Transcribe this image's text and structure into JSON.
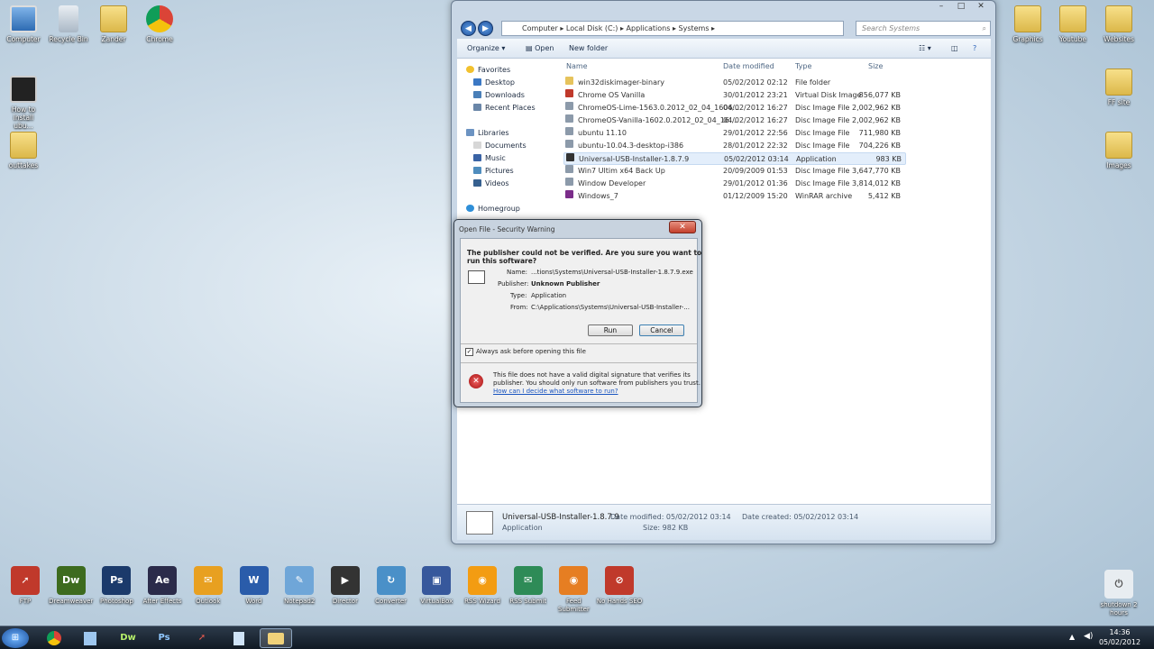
{
  "desktop": {
    "left_icons": [
      "Computer",
      "Recycle Bin",
      "Zander",
      "Chrome"
    ],
    "left_col": [
      "How to install ubu...",
      "outtakes"
    ],
    "right_icons": [
      "Graphics",
      "Youtube",
      "Websites"
    ],
    "right_col": [
      "FF site",
      "Images"
    ]
  },
  "explorer": {
    "breadcrumb": [
      "Computer",
      "Local Disk (C:)",
      "Applications",
      "Systems"
    ],
    "search_placeholder": "Search Systems",
    "toolbar": {
      "organize": "Organize ▾",
      "open": "Open",
      "new_folder": "New folder"
    },
    "nav": {
      "favorites": "Favorites",
      "desktop": "Desktop",
      "downloads": "Downloads",
      "recent": "Recent Places",
      "libraries": "Libraries",
      "documents": "Documents",
      "music": "Music",
      "pictures": "Pictures",
      "videos": "Videos",
      "homegroup": "Homegroup"
    },
    "columns": {
      "name": "Name",
      "date": "Date modified",
      "type": "Type",
      "size": "Size"
    },
    "files": [
      {
        "name": "win32diskimager-binary",
        "date": "05/02/2012 02:12",
        "type": "File folder",
        "size": ""
      },
      {
        "name": "Chrome OS Vanilla",
        "date": "30/01/2012 23:21",
        "type": "Virtual Disk Image",
        "size": "856,077 KB"
      },
      {
        "name": "ChromeOS-Lime-1563.0.2012_02_04_1606...",
        "date": "04/02/2012 16:27",
        "type": "Disc Image File",
        "size": "2,002,962 KB"
      },
      {
        "name": "ChromeOS-Vanilla-1602.0.2012_02_04_16...",
        "date": "04/02/2012 16:27",
        "type": "Disc Image File",
        "size": "2,002,962 KB"
      },
      {
        "name": "ubuntu 11.10",
        "date": "29/01/2012 22:56",
        "type": "Disc Image File",
        "size": "711,980 KB"
      },
      {
        "name": "ubuntu-10.04.3-desktop-i386",
        "date": "28/01/2012 22:32",
        "type": "Disc Image File",
        "size": "704,226 KB"
      },
      {
        "name": "Universal-USB-Installer-1.8.7.9",
        "date": "05/02/2012 03:14",
        "type": "Application",
        "size": "983 KB"
      },
      {
        "name": "Win7 Ultim x64 Back Up",
        "date": "20/09/2009 01:53",
        "type": "Disc Image File",
        "size": "3,647,770 KB"
      },
      {
        "name": "Window Developer",
        "date": "29/01/2012 01:36",
        "type": "Disc Image File",
        "size": "3,814,012 KB"
      },
      {
        "name": "Windows_7",
        "date": "01/12/2009 15:20",
        "type": "WinRAR archive",
        "size": "5,412 KB"
      }
    ],
    "details": {
      "name": "Universal-USB-Installer-1.8.7.9",
      "kind": "Application",
      "modified": "Date modified: 05/02/2012 03:14",
      "size": "Size: 982 KB",
      "created": "Date created: 05/02/2012 03:14"
    }
  },
  "dialog": {
    "title": "Open File - Security Warning",
    "close": "✕",
    "heading1": "The publisher could not be verified.  Are you sure you want to",
    "heading2": "run this software?",
    "labels": {
      "name": "Name:",
      "publisher": "Publisher:",
      "type": "Type:",
      "from": "From:"
    },
    "values": {
      "name": "...tions\\Systems\\Universal-USB-Installer-1.8.7.9.exe",
      "publisher": "Unknown Publisher",
      "type": "Application",
      "from": "C:\\Applications\\Systems\\Universal-USB-Installer-..."
    },
    "run": "Run",
    "cancel": "Cancel",
    "checkbox": "Always ask before opening this file",
    "warn1": "This file does not have a valid digital signature that verifies its",
    "warn2": "publisher.  You should only run software from publishers you trust.",
    "link": "How can I decide what software to run?"
  },
  "dock": [
    {
      "label": "FTP",
      "color": "#c0392b",
      "glyph": "➚"
    },
    {
      "label": "Dreamweaver",
      "color": "#3d6b1e",
      "glyph": "Dw"
    },
    {
      "label": "Photoshop",
      "color": "#1b3a6b",
      "glyph": "Ps"
    },
    {
      "label": "After Effects",
      "color": "#2b2b4a",
      "glyph": "Ae"
    },
    {
      "label": "Outlook",
      "color": "#e8a020",
      "glyph": "✉"
    },
    {
      "label": "Word",
      "color": "#2a5caa",
      "glyph": "W"
    },
    {
      "label": "Notepad2",
      "color": "#6fa6d8",
      "glyph": "✎"
    },
    {
      "label": "Director",
      "color": "#333",
      "glyph": "▶"
    },
    {
      "label": "Converter",
      "color": "#4a90c8",
      "glyph": "↻"
    },
    {
      "label": "VirtualBox",
      "color": "#37589c",
      "glyph": "▣"
    },
    {
      "label": "RSS Wizard",
      "color": "#f39c12",
      "glyph": "◉"
    },
    {
      "label": "RSS Submit",
      "color": "#2e8b57",
      "glyph": "✉"
    },
    {
      "label": "Feed Submitter",
      "color": "#e67e22",
      "glyph": "◉"
    },
    {
      "label": "No Hands SEO",
      "color": "#c0392b",
      "glyph": "⊘"
    }
  ],
  "shutdown": "shutdown 2 hours",
  "clock": {
    "time": "14:36",
    "date": "05/02/2012"
  }
}
